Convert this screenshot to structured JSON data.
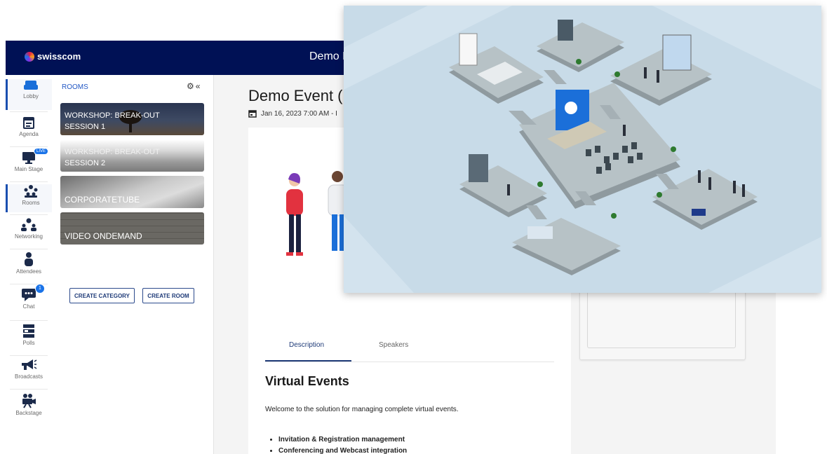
{
  "brand": {
    "name": "swisscom"
  },
  "topbar": {
    "title": "Demo E"
  },
  "nav": {
    "items": [
      {
        "label": "Lobby",
        "icon": "sofa-icon"
      },
      {
        "label": "Agenda",
        "icon": "calendar-icon"
      },
      {
        "label": "Main Stage",
        "icon": "monitor-icon",
        "badge": "LIVE"
      },
      {
        "label": "Rooms",
        "icon": "rooms-icon"
      },
      {
        "label": "Networking",
        "icon": "networking-icon"
      },
      {
        "label": "Attendees",
        "icon": "person-icon"
      },
      {
        "label": "Chat",
        "icon": "chat-icon",
        "badge": "1"
      },
      {
        "label": "Polls",
        "icon": "polls-icon"
      },
      {
        "label": "Broadcasts",
        "icon": "megaphone-icon"
      },
      {
        "label": "Backstage",
        "icon": "camera-icon"
      }
    ]
  },
  "rooms": {
    "heading": "ROOMS",
    "items": [
      {
        "line1": "WORKSHOP: BREAK-OUT",
        "line2": "SESSION 1"
      },
      {
        "line1": "WORKSHOP: BREAK-OUT",
        "line2": "SESSION 2"
      },
      {
        "line1": "CORPORATETUBE"
      },
      {
        "line1": "VIDEO ONDEMAND"
      }
    ],
    "create_category": "CREATE CATEGORY",
    "create_room": "CREATE ROOM"
  },
  "event": {
    "title": "Demo Event (",
    "date": "Jan 16, 2023 7:00 AM - I"
  },
  "tabs": {
    "description": "Description",
    "speakers": "Speakers"
  },
  "body": {
    "heading": "Virtual Events",
    "welcome": "Welcome to the solution for managing complete virtual events.",
    "bullets": [
      "Invitation & Registration management",
      "Conferencing and Webcast integration"
    ]
  },
  "colors": {
    "topbar": "#001155",
    "accent": "#2459c5",
    "overlay_bg": "#c8dbe8"
  }
}
